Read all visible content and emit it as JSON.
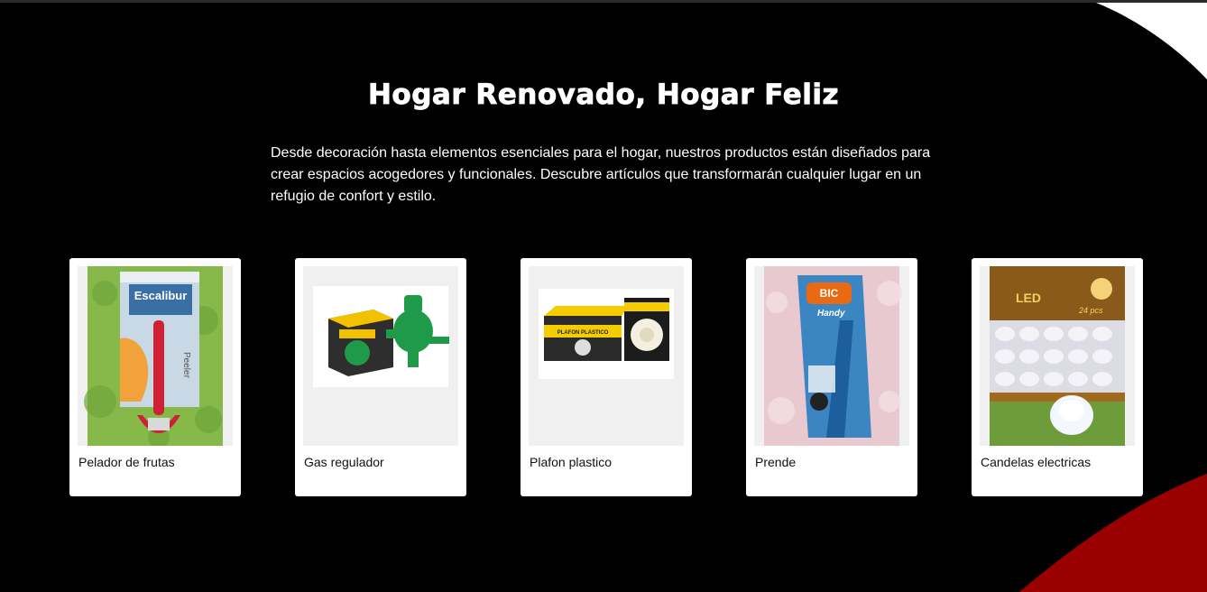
{
  "section": {
    "title": "Hogar Renovado, Hogar Feliz",
    "description": "Desde decoración hasta elementos esenciales para el hogar, nuestros productos están diseñados para crear espacios acogedores y funcionales. Descubre artículos que transformarán cualquier lugar en un refugio de confort y estilo."
  },
  "products": [
    {
      "name": "Pelador de frutas",
      "image_brand_text": "Escalibur",
      "image_side_text": "Peeler"
    },
    {
      "name": "Gas regulador"
    },
    {
      "name": "Plafon plastico",
      "image_box_text": "PLAFON PLASTICO"
    },
    {
      "name": "Prende",
      "image_brand_text": "BIC",
      "image_sub_text": "Handy"
    },
    {
      "name": "Candelas electricas",
      "image_box_text": "LED",
      "image_count_text": "24 pcs"
    }
  ],
  "colors": {
    "background": "#000000",
    "accent_red": "#9a0000",
    "card_bg": "#ffffff"
  }
}
